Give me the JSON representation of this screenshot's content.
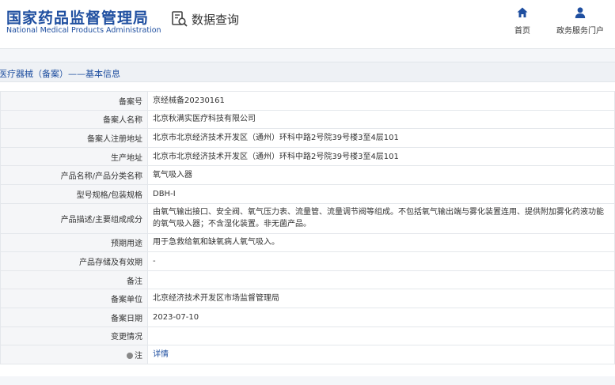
{
  "header": {
    "logo_cn": "国家药品监督管理局",
    "logo_en": "National Medical Products Administration",
    "search_label": "数据查询",
    "nav_home": "首页",
    "nav_gov": "政务服务门户"
  },
  "breadcrumb": "医疗器械（备案）——基本信息",
  "rows": [
    {
      "label": "备案号",
      "value": "京经械备20230161"
    },
    {
      "label": "备案人名称",
      "value": "北京秋满实医疗科技有限公司"
    },
    {
      "label": "备案人注册地址",
      "value": "北京市北京经济技术开发区（通州）环科中路2号院39号楼3至4层101"
    },
    {
      "label": "生产地址",
      "value": "北京市北京经济技术开发区（通州）环科中路2号院39号楼3至4层101"
    },
    {
      "label": "产品名称/产品分类名称",
      "value": "氧气吸入器"
    },
    {
      "label": "型号规格/包装规格",
      "value": "DBH-I"
    },
    {
      "label": "产品描述/主要组成成分",
      "value": "由氧气输出接口、安全阀、氧气压力表、流量管、流量调节阀等组成。不包括氧气输出端与雾化装置连用、提供附加雾化药液功能的氧气吸入器；不含湿化装置。非无菌产品。"
    },
    {
      "label": "预期用途",
      "value": "用于急救给氧和缺氧病人氧气吸入。"
    },
    {
      "label": "产品存储及有效期",
      "value": "-"
    },
    {
      "label": "备注",
      "value": ""
    },
    {
      "label": "备案单位",
      "value": "北京经济技术开发区市场监督管理局"
    },
    {
      "label": "备案日期",
      "value": "2023-07-10"
    },
    {
      "label": "变更情况",
      "value": ""
    }
  ],
  "note_row": {
    "label": "注",
    "link": "详情"
  },
  "colors": {
    "brand_blue": "#1f4fa0",
    "label_bg": "#f5f6f8",
    "border": "#e4e7eb"
  },
  "icons": {
    "search": "search-document-icon",
    "home": "home-icon",
    "user": "user-icon",
    "note": "info-dot-icon"
  }
}
